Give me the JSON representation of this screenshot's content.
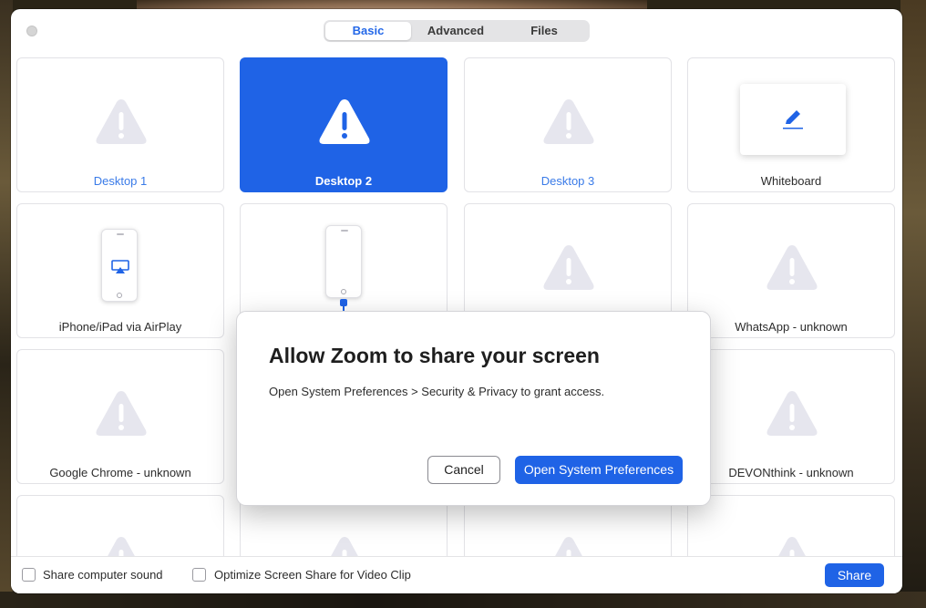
{
  "tabs": [
    {
      "label": "Basic",
      "active": true
    },
    {
      "label": "Advanced",
      "active": false
    },
    {
      "label": "Files",
      "active": false
    }
  ],
  "tiles": {
    "desktop1": "Desktop 1",
    "desktop2": "Desktop 2",
    "desktop3": "Desktop 3",
    "whiteboard": "Whiteboard",
    "airplay": "iPhone/iPad via AirPlay",
    "whatsapp": "WhatsApp - unknown",
    "chrome": "Google Chrome - unknown",
    "devonthink": "DEVONthink - unknown"
  },
  "footer": {
    "share_sound": "Share computer sound",
    "optimize_video": "Optimize Screen Share for Video Clip",
    "share_button": "Share"
  },
  "dialog": {
    "title": "Allow Zoom to share your screen",
    "message": "Open System Preferences > Security & Privacy to grant access.",
    "cancel": "Cancel",
    "open_prefs": "Open System Preferences"
  },
  "colors": {
    "accent": "#1f63e6",
    "warning_icon": "#e6e6ee",
    "label_blue": "#3a7be8"
  },
  "icons": {
    "warning": "warning-triangle-icon",
    "pen": "pen-icon",
    "airplay": "airplay-icon",
    "phone": "phone-icon"
  }
}
